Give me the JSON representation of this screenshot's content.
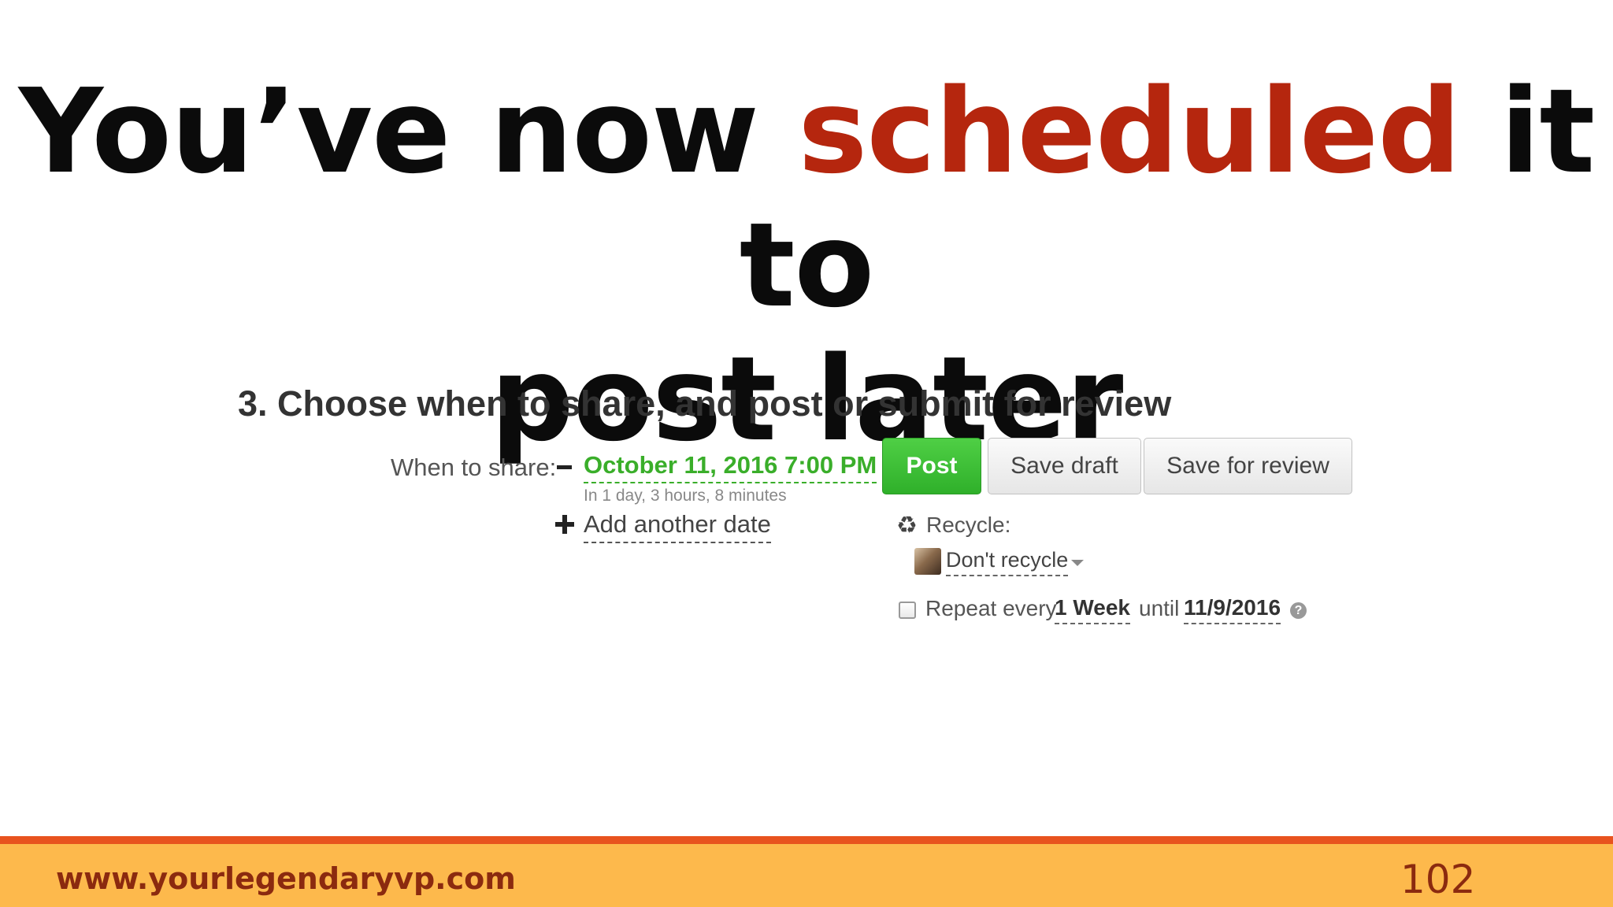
{
  "slide": {
    "title_part1": "You’ve now ",
    "title_accent": "scheduled",
    "title_part2": " it to",
    "title_line2": "post later",
    "accent_color": "#b5260e"
  },
  "share_panel": {
    "heading": "3. Choose when to share, and post or submit for review",
    "when_label": "When to share:",
    "scheduled_date": "October 11, 2016 7:00 PM",
    "relative_time": "In 1 day, 3 hours, 8 minutes",
    "add_date_label": "Add another date",
    "buttons": {
      "post": "Post",
      "save_draft": "Save draft",
      "save_review": "Save for review"
    },
    "recycle": {
      "icon": "recycle-icon",
      "label": "Recycle:",
      "selected": "Don't recycle"
    },
    "repeat": {
      "checked": false,
      "prefix": "Repeat every",
      "interval": "1 Week",
      "until_label": "until",
      "until_date": "11/9/2016",
      "help_icon": "?"
    },
    "colors": {
      "post_button": "#3aae2a",
      "date_link": "#3aae2a"
    }
  },
  "footer": {
    "url": "www.yourlegendaryvp.com",
    "page_number": "102",
    "bar_color": "#fdb94c",
    "stripe_color": "#e8531e"
  }
}
